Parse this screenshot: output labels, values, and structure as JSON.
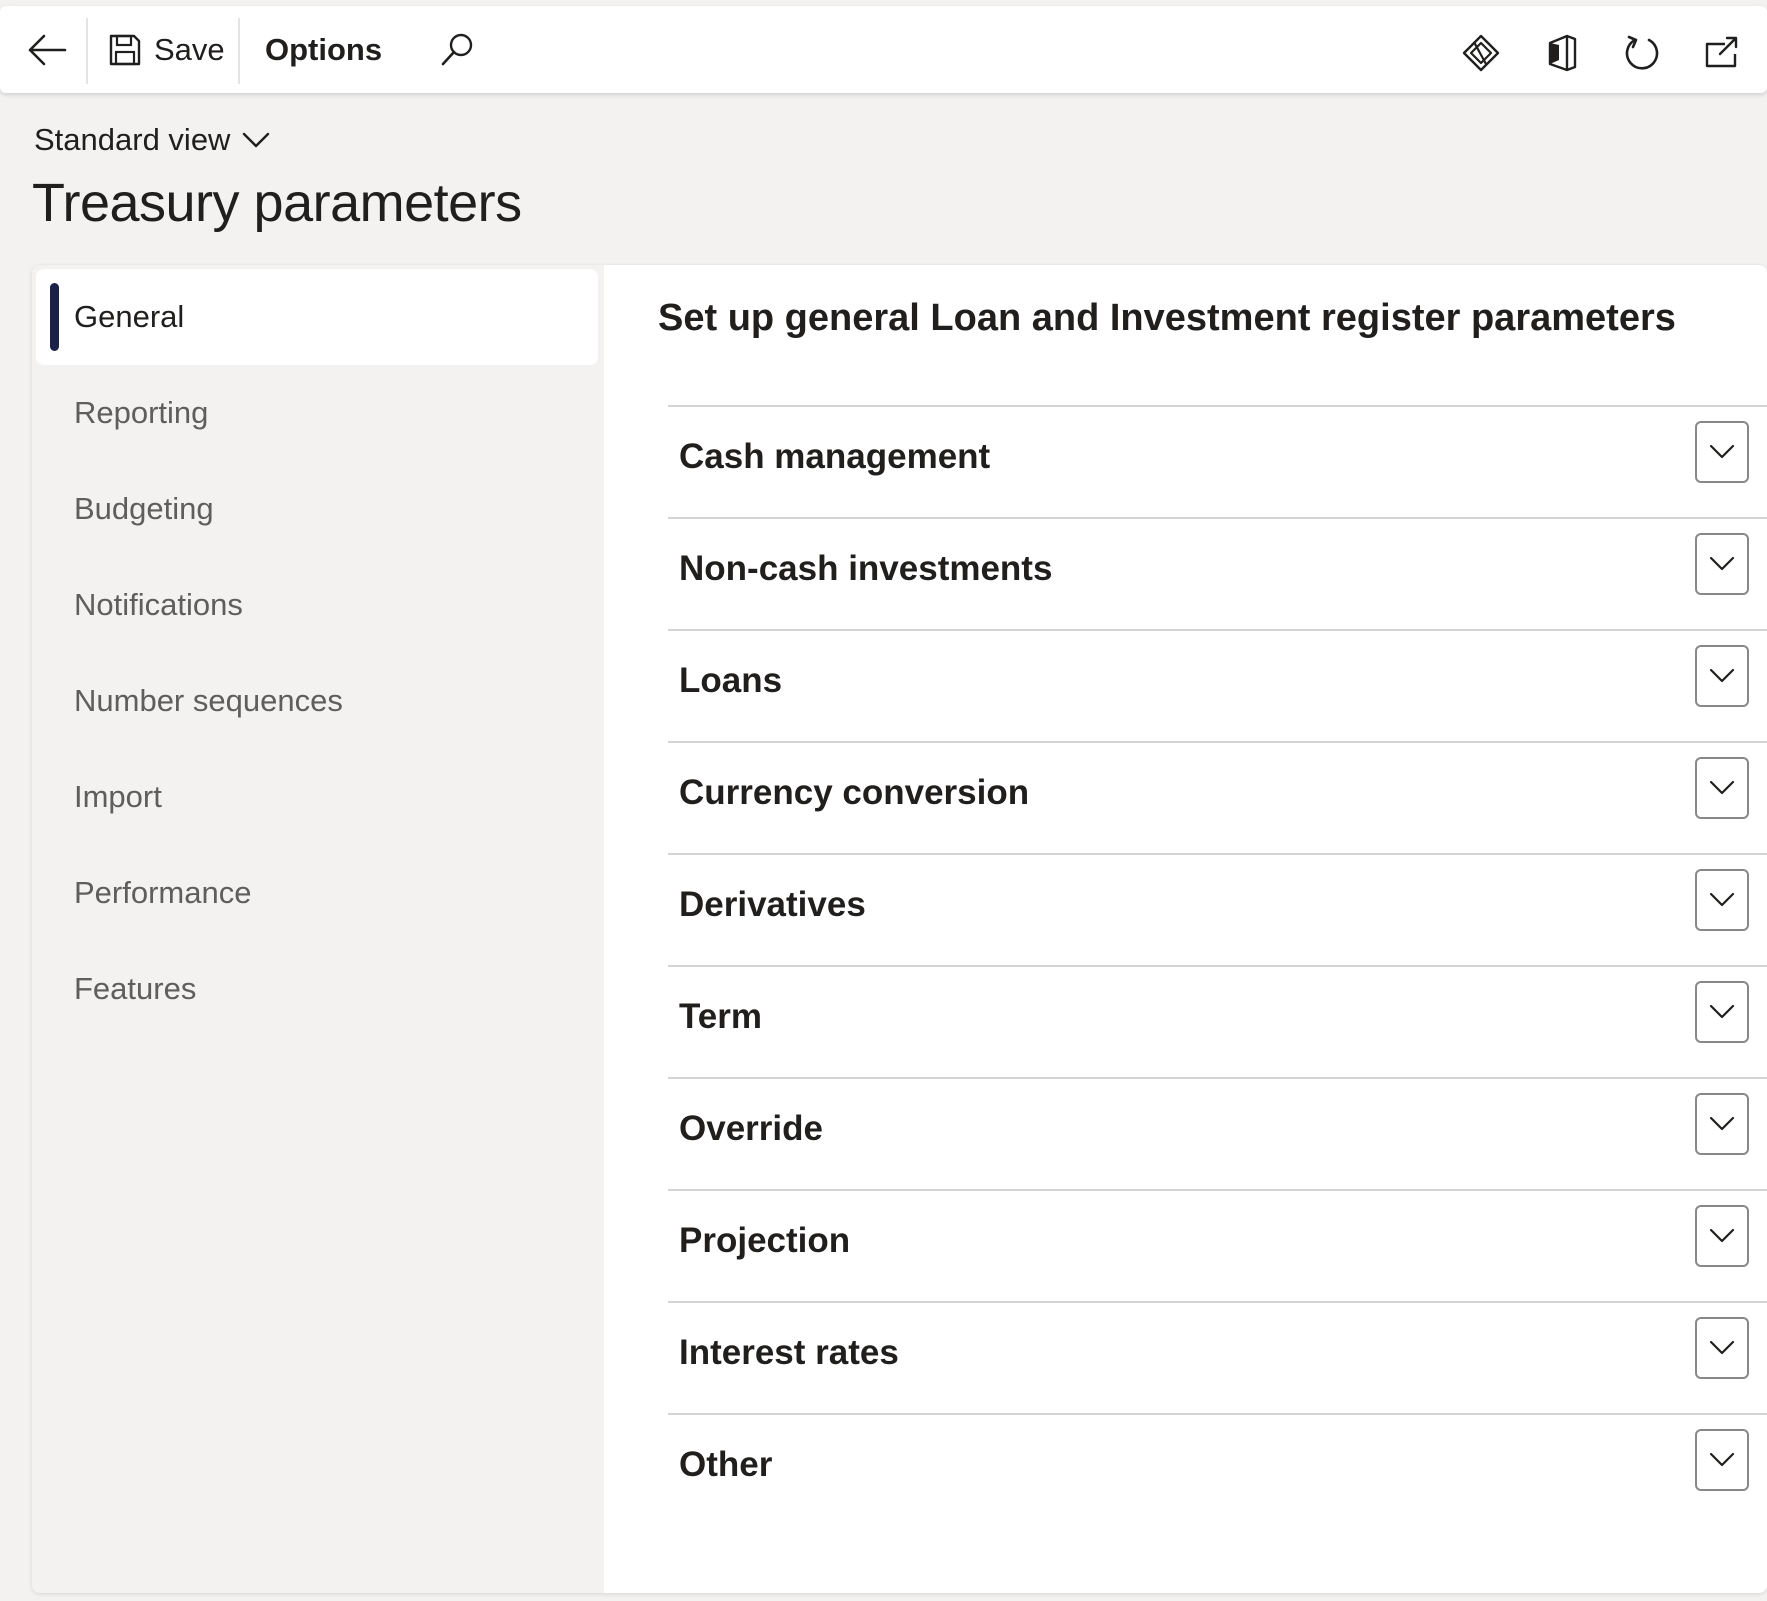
{
  "toolbar": {
    "save_label": "Save",
    "options_label": "Options",
    "icons": [
      "back-arrow-icon",
      "save-icon",
      "search-icon",
      "power-apps-icon",
      "office-icon",
      "refresh-icon",
      "open-in-new-window-icon"
    ]
  },
  "header": {
    "view_label": "Standard view",
    "title": "Treasury parameters"
  },
  "nav": {
    "items": [
      {
        "label": "General",
        "selected": true
      },
      {
        "label": "Reporting"
      },
      {
        "label": "Budgeting"
      },
      {
        "label": "Notifications"
      },
      {
        "label": "Number sequences"
      },
      {
        "label": "Import"
      },
      {
        "label": "Performance"
      },
      {
        "label": "Features"
      }
    ]
  },
  "content": {
    "heading": "Set up general Loan and Investment register parameters",
    "sections": [
      {
        "label": "Cash management"
      },
      {
        "label": "Non-cash investments"
      },
      {
        "label": "Loans"
      },
      {
        "label": "Currency conversion"
      },
      {
        "label": "Derivatives"
      },
      {
        "label": "Term"
      },
      {
        "label": "Override"
      },
      {
        "label": "Projection"
      },
      {
        "label": "Interest rates"
      },
      {
        "label": "Other"
      }
    ]
  },
  "colors": {
    "accent": "#1b2148",
    "background": "#f3f2f1",
    "surface": "#ffffff",
    "text": "#201f1e",
    "muted_text": "#605e5c"
  }
}
